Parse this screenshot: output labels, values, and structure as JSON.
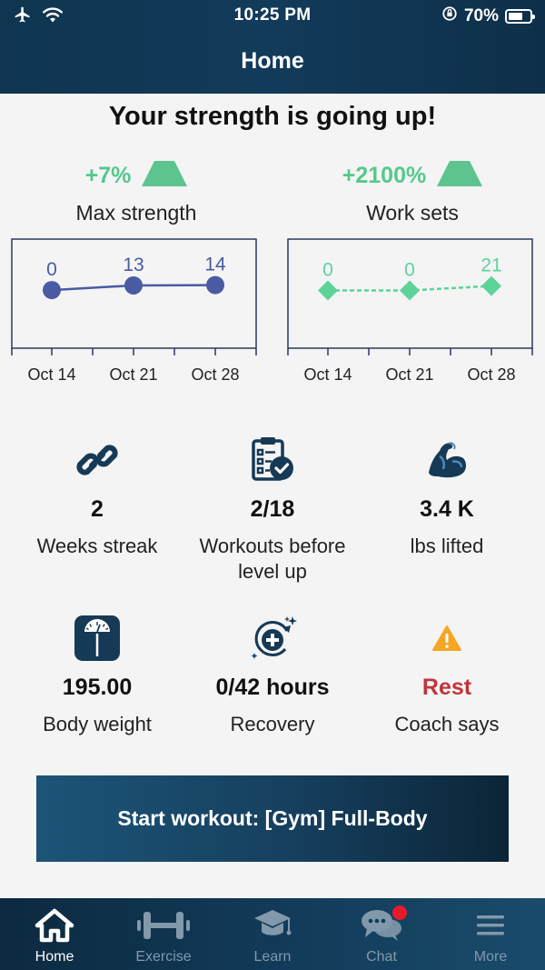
{
  "status_bar": {
    "time": "10:25 PM",
    "battery_pct": "70%",
    "battery_level": 0.7
  },
  "header": {
    "title": "Home"
  },
  "headline": "Your strength is going up!",
  "charts": [
    {
      "change": "+7%",
      "title": "Max strength",
      "color": "#4a5aa3",
      "line_style": "solid",
      "marker": "circle"
    },
    {
      "change": "+2100%",
      "title": "Work sets",
      "color": "#5dd39a",
      "line_style": "dashed",
      "marker": "diamond"
    }
  ],
  "chart_data": [
    {
      "type": "line",
      "categories": [
        "Oct 14",
        "Oct 21",
        "Oct 28"
      ],
      "values": [
        0,
        13,
        14
      ],
      "value_labels": [
        "0",
        "13",
        "14"
      ],
      "title": "Max strength",
      "ylim": [
        -150,
        130
      ],
      "grid": false
    },
    {
      "type": "line",
      "categories": [
        "Oct 14",
        "Oct 21",
        "Oct 28"
      ],
      "values": [
        0,
        0,
        21
      ],
      "value_labels": [
        "0",
        "0",
        "21"
      ],
      "title": "Work sets",
      "ylim": [
        -250,
        220
      ],
      "grid": false
    }
  ],
  "stats": [
    {
      "icon": "link-icon",
      "value": "2",
      "label": "Weeks streak"
    },
    {
      "icon": "clipboard-check-icon",
      "value": "2/18",
      "label": "Workouts before level up"
    },
    {
      "icon": "flexed-arm-icon",
      "value": "3.4 K",
      "label": "lbs lifted"
    },
    {
      "icon": "scale-icon",
      "value": "195.00",
      "label": "Body weight"
    },
    {
      "icon": "recovery-plus-icon",
      "value": "0/42 hours",
      "label": "Recovery"
    },
    {
      "icon": "warning-icon",
      "value": "Rest",
      "label": "Coach says"
    }
  ],
  "start_button": {
    "label": "Start workout: [Gym] Full-Body"
  },
  "tabs": [
    {
      "label": "Home",
      "icon": "home-icon",
      "active": true
    },
    {
      "label": "Exercise",
      "icon": "dumbbell-icon",
      "active": false
    },
    {
      "label": "Learn",
      "icon": "graduation-cap-icon",
      "active": false
    },
    {
      "label": "Chat",
      "icon": "chat-bubbles-icon",
      "active": false,
      "badge": true
    },
    {
      "label": "More",
      "icon": "menu-icon",
      "active": false
    }
  ],
  "colors": {
    "accent_green": "#55c88e",
    "chart_blue": "#4a5aa3",
    "rest_red": "#c0353a",
    "warning_orange": "#f5a623",
    "navy": "#163a56"
  }
}
